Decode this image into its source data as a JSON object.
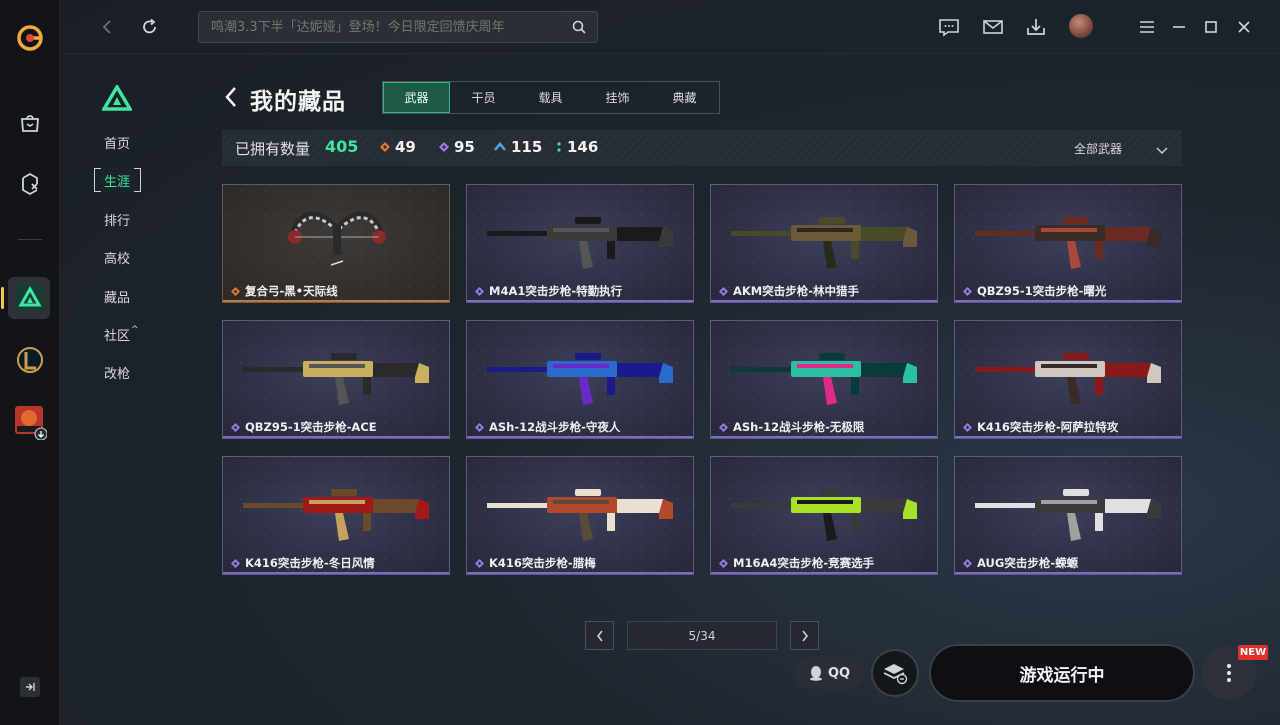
{
  "topbar": {
    "search_placeholder": "鸣潮3.3下半「达妮娅」登场！今日限定回馈庆周年"
  },
  "subnav": {
    "items": [
      {
        "label": "首页",
        "active": false
      },
      {
        "label": "生涯",
        "active": true
      },
      {
        "label": "排行",
        "active": false
      },
      {
        "label": "高校",
        "active": false
      },
      {
        "label": "藏品",
        "active": false
      },
      {
        "label": "社区",
        "active": false
      },
      {
        "label": "改枪",
        "active": false
      }
    ],
    "community_caret": "^"
  },
  "header": {
    "title": "我的藏品",
    "tabs": [
      "武器",
      "干员",
      "载具",
      "挂饰",
      "典藏"
    ],
    "active_tab": "武器"
  },
  "stats": {
    "owned_label": "已拥有数量",
    "owned_count": "405",
    "rarity_counts": [
      {
        "value": "49",
        "color": "#e07a2a",
        "icon": "diamond-orange-icon"
      },
      {
        "value": "95",
        "color": "#9a7ae8",
        "icon": "diamond-purple-icon"
      },
      {
        "value": "115",
        "color": "#4aa8e8",
        "icon": "chevron-blue-icon"
      },
      {
        "value": "146",
        "color": "#3ee6a0",
        "icon": "dots-green-icon"
      }
    ],
    "filter_label": "全部武器"
  },
  "items": [
    {
      "name": "复合弓-黑•天际线",
      "rarity": "orange"
    },
    {
      "name": "M4A1突击步枪-特勤执行",
      "rarity": "purple"
    },
    {
      "name": "AKM突击步枪-林中猎手",
      "rarity": "purple"
    },
    {
      "name": "QBZ95-1突击步枪-曙光",
      "rarity": "purple"
    },
    {
      "name": "QBZ95-1突击步枪-ACE",
      "rarity": "purple"
    },
    {
      "name": "ASh-12战斗步枪-守夜人",
      "rarity": "purple"
    },
    {
      "name": "ASh-12战斗步枪-无极限",
      "rarity": "purple"
    },
    {
      "name": "K416突击步枪-阿萨拉特攻",
      "rarity": "purple"
    },
    {
      "name": "K416突击步枪-冬日风情",
      "rarity": "purple"
    },
    {
      "name": "K416突击步枪-腊梅",
      "rarity": "purple"
    },
    {
      "name": "M16A4突击步枪-竞赛选手",
      "rarity": "purple"
    },
    {
      "name": "AUG突击步枪-蝾螈",
      "rarity": "purple"
    }
  ],
  "pagination": {
    "current": "5/34"
  },
  "bottom": {
    "qq_label": "QQ",
    "game_status": "游戏运行中",
    "new_badge": "NEW"
  },
  "colors": {
    "accent_green": "#3ee6a0",
    "purple_rarity": "#9a7ae8",
    "orange_rarity": "#e07a2a"
  }
}
